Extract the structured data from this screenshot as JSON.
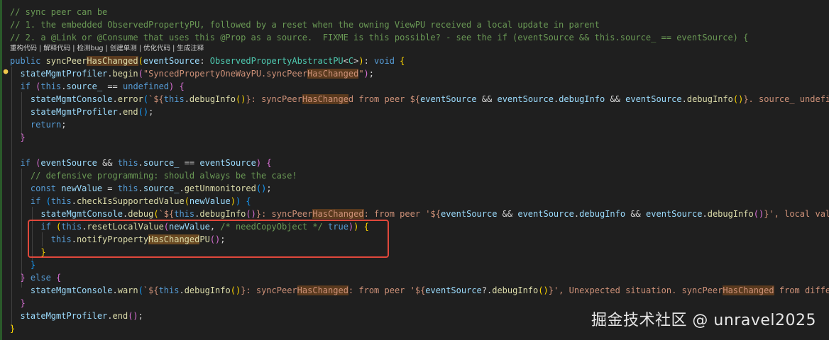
{
  "codelens": "重构代码 | 解释代码 | 检测bug | 创建单测 | 优化代码 | 生成注释",
  "watermark": "掘金技术社区 @ unravel2025",
  "highlight_word": "HasChanged",
  "lines": [
    "// sync peer can be",
    "// 1. the embedded ObservedPropertyPU, followed by a reset when the owning ViewPU received a local update in parent",
    "// 2. a @Link or @Consume that uses this @Prop as a source.  FIXME is this possible? - see the if (eventSource && this.source_ == eventSource) {",
    "public syncPeerHasChanged(eventSource: ObservedPropertyAbstractPU<C>): void {",
    "  stateMgmtProfiler.begin(\"SyncedPropertyOneWayPU.syncPeerHasChanged\");",
    "  if (this.source_ == undefined) {",
    "    stateMgmtConsole.error(`${this.debugInfo()}: syncPeerHasChanged from peer ${eventSource && eventSource.debugInfo && eventSource.debugInfo()}. source_ undefi",
    "    stateMgmtProfiler.end();",
    "    return;",
    "  }",
    "",
    "  if (eventSource && this.source_ == eventSource) {",
    "    // defensive programming: should always be the case!",
    "    const newValue = this.source_.getUnmonitored();",
    "    if (this.checkIsSupportedValue(newValue)) {",
    "      stateMgmtConsole.debug(`${this.debugInfo()}: syncPeerHasChanged: from peer '${eventSource && eventSource.debugInfo && eventSource.debugInfo()}', local val",
    "      if (this.resetLocalValue(newValue, /* needCopyObject */ true)) {",
    "        this.notifyPropertyHasChangedPU();",
    "      }",
    "    }",
    "  } else {",
    "    stateMgmtConsole.warn(`${this.debugInfo()}: syncPeerHasChanged: from peer '${eventSource?.debugInfo()}', Unexpected situation. syncPeerHasChanged from diffe",
    "  }",
    "  stateMgmtProfiler.end();",
    "}"
  ]
}
